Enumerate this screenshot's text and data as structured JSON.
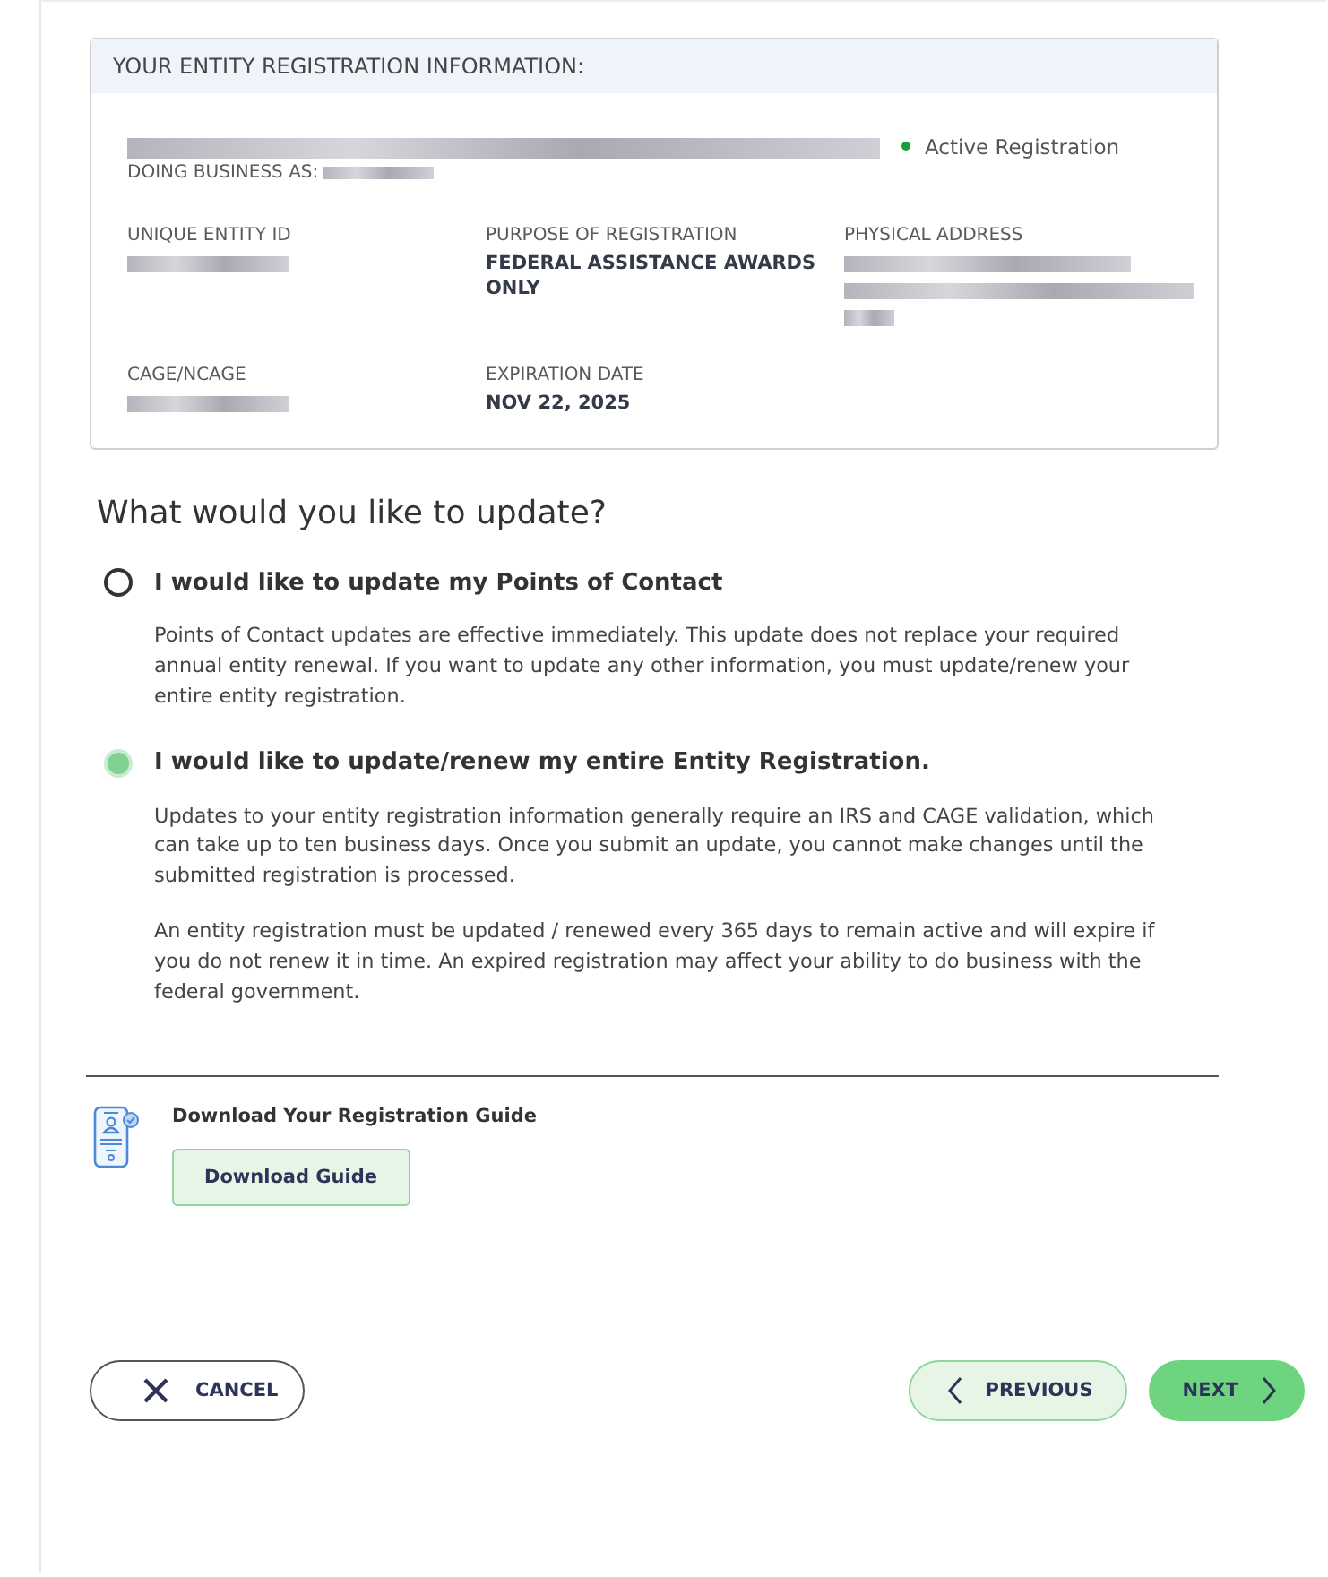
{
  "entity_card": {
    "title": "YOUR ENTITY REGISTRATION INFORMATION:",
    "status": {
      "label": "Active Registration",
      "color": "#1a9e3a"
    },
    "dba_label": "DOING BUSINESS AS:",
    "fields": [
      {
        "label": "UNIQUE ENTITY ID",
        "kind": "redacted"
      },
      {
        "label": "PURPOSE OF REGISTRATION",
        "kind": "value",
        "value": "FEDERAL ASSISTANCE AWARDS ONLY"
      },
      {
        "label": "PHYSICAL ADDRESS",
        "kind": "redacted_block"
      },
      {
        "label": "CAGE/NCAGE",
        "kind": "redacted"
      },
      {
        "label": "EXPIRATION DATE",
        "kind": "value",
        "value": "NOV 22, 2025"
      }
    ]
  },
  "question": "What would you like to update?",
  "options": [
    {
      "label": "I would like to update my Points of Contact",
      "selected": false,
      "paragraphs": [
        "Points of Contact updates are effective immediately. This update does not replace your required annual entity renewal. If you want to update any other information, you must update/renew your entire entity registration."
      ]
    },
    {
      "label": "I would like to update/renew my entire Entity Registration.",
      "selected": true,
      "paragraphs": [
        "Updates to your entity registration information generally require an IRS and CAGE validation, which can take up to ten business days. Once you submit an update, you cannot make changes until the submitted registration is processed.",
        "An entity registration must be updated / renewed every 365 days to remain active and will expire if you do not renew it in time. An expired registration may affect your ability to do business with the federal government."
      ]
    }
  ],
  "guide": {
    "title": "Download Your Registration Guide",
    "button": "Download Guide"
  },
  "footer": {
    "cancel": "CANCEL",
    "previous": "PREVIOUS",
    "next": "NEXT"
  }
}
